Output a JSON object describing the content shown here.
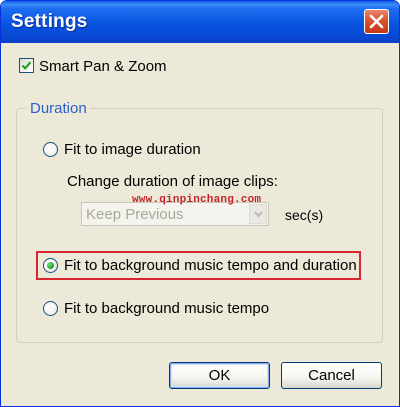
{
  "window": {
    "title": "Settings",
    "close_icon": "close-icon"
  },
  "smart_pan_zoom": {
    "label": "Smart Pan & Zoom",
    "checked": true
  },
  "duration_group": {
    "legend": "Duration",
    "options": [
      {
        "label": "Fit to image duration",
        "selected": false
      },
      {
        "label": "Fit to background music tempo and duration",
        "selected": true
      },
      {
        "label": "Fit to background music tempo",
        "selected": false
      }
    ],
    "change_duration_label": "Change duration of image clips:",
    "duration_select": {
      "value": "Keep Previous",
      "disabled": true
    },
    "units_label": "sec(s)"
  },
  "watermark": "www.qinpinchang.com",
  "buttons": {
    "ok": "OK",
    "cancel": "Cancel"
  },
  "colors": {
    "highlight": "#d8252f",
    "titlebar": "#0a54e0",
    "legend": "#2b5fc7"
  }
}
